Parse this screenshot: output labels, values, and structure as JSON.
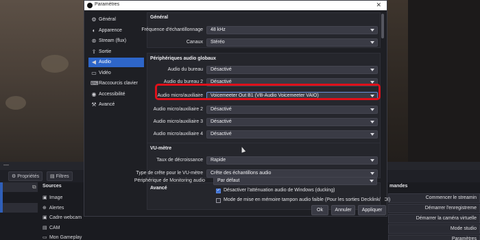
{
  "dialog": {
    "title": "Paramètres",
    "close_glyph": "✕",
    "footer": {
      "ok": "Ok",
      "cancel": "Annuler",
      "apply": "Appliquer"
    }
  },
  "sidebar": {
    "items": [
      {
        "label": "Général",
        "icon": "gear-icon",
        "glyph": "⚙"
      },
      {
        "label": "Apparence",
        "icon": "palette-icon",
        "glyph": "◐"
      },
      {
        "label": "Stream (flux)",
        "icon": "globe-icon",
        "glyph": "⊛"
      },
      {
        "label": "Sortie",
        "icon": "output-icon",
        "glyph": "⇪"
      },
      {
        "label": "Audio",
        "icon": "speaker-icon",
        "glyph": "◀"
      },
      {
        "label": "Vidéo",
        "icon": "monitor-icon",
        "glyph": "▭"
      },
      {
        "label": "Raccourcis clavier",
        "icon": "keyboard-icon",
        "glyph": "⌨"
      },
      {
        "label": "Accessibilité",
        "icon": "accessibility-icon",
        "glyph": "◉"
      },
      {
        "label": "Avancé",
        "icon": "wrench-icon",
        "glyph": "⚒"
      }
    ],
    "active_index": 4
  },
  "general_section": {
    "title": "Général",
    "sample_rate_label": "Fréquence d'échantillonnage",
    "sample_rate_value": "48 kHz",
    "channels_label": "Canaux",
    "channels_value": "Stéréo"
  },
  "global_audio_section": {
    "title": "Périphériques audio globaux",
    "rows": [
      {
        "label": "Audio du bureau",
        "value": "Désactivé"
      },
      {
        "label": "Audio du bureau 2",
        "value": "Désactivé"
      },
      {
        "label": "Audio micro/auxiliaire",
        "value": "Voicemeeter Out B1 (VB-Audio Voicemeeter VAIO)"
      },
      {
        "label": "Audio micro/auxiliaire 2",
        "value": "Désactivé"
      },
      {
        "label": "Audio micro/auxiliaire 3",
        "value": "Désactivé"
      },
      {
        "label": "Audio micro/auxiliaire 4",
        "value": "Désactivé"
      }
    ]
  },
  "vu_section": {
    "title": "VU-mètre",
    "decay_label": "Taux de décroissance",
    "decay_value": "Rapide",
    "peak_label": "Type de crête pour le VU-mètre",
    "peak_value": "Crête des échantillons audio"
  },
  "advanced_section": {
    "title": "Avancé",
    "monitoring_label": "Périphérique de Monitoring audio",
    "monitoring_value": "Par défaut",
    "ducking_label": "Désactiver l'atténuation audio de Windows (ducking)",
    "ducking_checked": true,
    "buffer_label": "Mode de mise en mémoire tampon audio faible (Pour les sorties Decklink/NDI)",
    "buffer_checked": false
  },
  "main_window": {
    "toolbar": {
      "properties": "Propriétés",
      "filters": "Filtres"
    },
    "sources_header": "Sources",
    "controls_header": "mandes",
    "sources": [
      {
        "label": "Image",
        "icon": "image-icon",
        "glyph": "▣"
      },
      {
        "label": "Alertes",
        "icon": "globe-icon",
        "glyph": "⊕"
      },
      {
        "label": "Cadre webcam",
        "icon": "image-icon",
        "glyph": "▣"
      },
      {
        "label": "CAM",
        "icon": "camera-icon",
        "glyph": "▤"
      },
      {
        "label": "Mon Gameplay",
        "icon": "monitor-icon",
        "glyph": "▭"
      }
    ],
    "controls": [
      "Commencer le streamin",
      "Démarrer l'enregistreme",
      "Démarrer la caméra virtuelle",
      "Mode studio",
      "Paramètres"
    ]
  }
}
